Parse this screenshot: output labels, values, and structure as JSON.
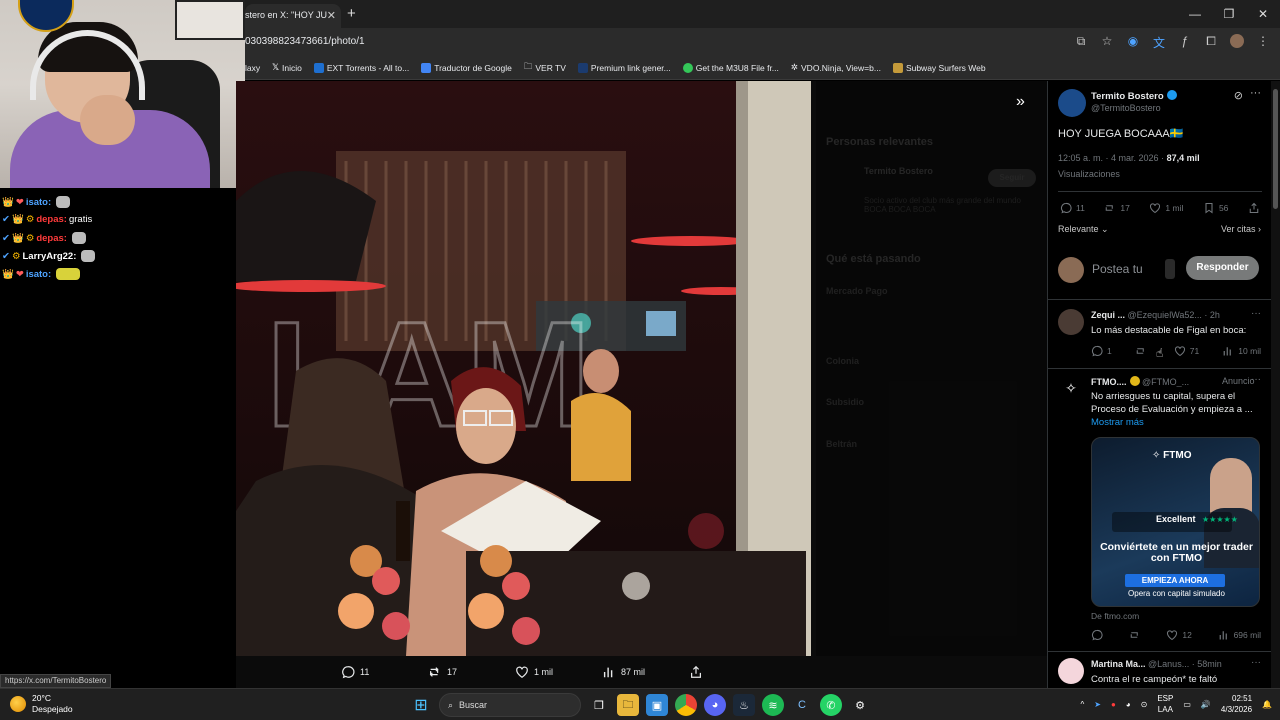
{
  "browser": {
    "tab_title": "stero en X: \"HOY JU",
    "url": "030398823473661/photo/1",
    "bookmarks": [
      {
        "label": "laxy",
        "color": "#555555"
      },
      {
        "label": "Inicio",
        "color": "#000000"
      },
      {
        "label": "EXT Torrents - All to...",
        "color": "#1e6fd0"
      },
      {
        "label": "Traductor de Google",
        "color": "#4285f4"
      },
      {
        "label": "VER TV",
        "color": "#888888"
      },
      {
        "label": "Premium link gener...",
        "color": "#1b3b6f"
      },
      {
        "label": "Get the M3U8 File fr...",
        "color": "#34c759"
      },
      {
        "label": "VDO.Ninja, View=b...",
        "color": "#ffffff"
      },
      {
        "label": "Subway Surfers Web",
        "color": "#c49a3a"
      }
    ],
    "status_url": "https://x.com/TermitoBostero"
  },
  "chat": {
    "messages": [
      {
        "user": "isato:",
        "text": "",
        "color": "#4ea3ff"
      },
      {
        "user": "depas:",
        "text": "gratis",
        "color": "#ff3b3b"
      },
      {
        "user": "depas:",
        "text": "",
        "color": "#ff3b3b"
      },
      {
        "user": "LarryArg22:",
        "text": "",
        "color": "#ffffff"
      },
      {
        "user": "isato:",
        "text": "",
        "color": "#4ea3ff"
      }
    ]
  },
  "photo_actions": {
    "replies": "11",
    "retweets": "17",
    "likes": "1 mil",
    "views": "87 mil"
  },
  "dim_panel": {
    "relevant_title": "Personas relevantes",
    "relevant_name": "Termito Bostero",
    "relevant_bio": "Socio activo del club más grande del mundo BOCA BOCA BOCA",
    "follow": "Seguir",
    "whats_happening": "Qué está pasando",
    "items": [
      "Mercado Pago",
      "Colonia",
      "Subsidio",
      "Beltrán"
    ]
  },
  "tweet": {
    "author": "Termito Bostero",
    "handle": "@TermitoBostero",
    "text": "HOY JUEGA BOCAAA🇸🇪",
    "time": "12:05 a. m. · 4 mar. 2026 ·",
    "views": "87,4 mil",
    "views_label": "Visualizaciones",
    "stats": {
      "replies": "11",
      "retweets": "17",
      "likes": "1 mil",
      "bookmarks": "56"
    },
    "sort": "Relevante",
    "quotes": "Ver citas",
    "reply_placeholder": "Postea tu",
    "reply_button": "Responder"
  },
  "replies": [
    {
      "name": "Zequi ...",
      "handle": "@EzequielWa52...",
      "time": "· 2h",
      "text": "Lo más destacable de Figal en boca:",
      "stats": {
        "replies": "1",
        "retweets": "",
        "likes": "71",
        "views": "10 mil"
      }
    }
  ],
  "ad": {
    "name": "FTMO....",
    "handle": "@FTMO_...",
    "label": "Anuncio",
    "text": "No arriesgues tu capital, supera el Proceso de Evaluación y empieza a ...",
    "more": "Mostrar más",
    "card_brand": "FTMO",
    "card_rating": "Excellent",
    "card_headline": "Conviértete en un mejor trader con FTMO",
    "card_cta": "EMPIEZA AHORA",
    "card_sub": "Opera con capital simulado",
    "domain": "De ftmo.com",
    "stats": {
      "likes": "12",
      "views": "696 mil"
    }
  },
  "next_reply": {
    "name": "Martina Ma...",
    "handle": "@Lanus...",
    "time": "· 58min",
    "text": "Contra el re campeón* te faltó"
  },
  "taskbar": {
    "temp": "20°C",
    "weather": "Despejado",
    "search": "Buscar",
    "lang1": "ESP",
    "lang2": "LAA",
    "time": "02:51",
    "date": "4/3/2026"
  }
}
